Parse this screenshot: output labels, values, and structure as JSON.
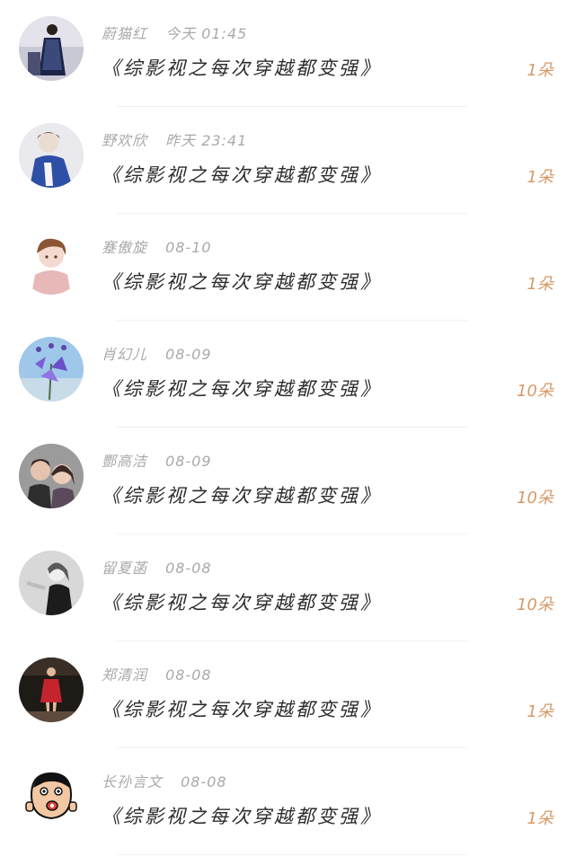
{
  "messages": [
    {
      "name": "蔚猫红",
      "time": "今天 01:45",
      "title": "《综影视之每次穿越都变强》",
      "count": "1朵",
      "avatar_icon": "woman-in-navy-dress-avatar",
      "avatar_colors": [
        "#3b4a7a",
        "#c9c9d6",
        "#1c2448"
      ]
    },
    {
      "name": "野欢欣",
      "time": "昨天 23:41",
      "title": "《综影视之每次穿越都变强》",
      "count": "1朵",
      "avatar_icon": "young-man-blue-outfit-avatar",
      "avatar_colors": [
        "#2e4fa6",
        "#e9ddd2",
        "#7a5a3a"
      ]
    },
    {
      "name": "蹇傲旋",
      "time": "08-10",
      "title": "《综影视之每次穿越都变强》",
      "count": "1朵",
      "avatar_icon": "anime-boy-avatar",
      "avatar_colors": [
        "#8a5532",
        "#f3d9cf",
        "#e8b7b8"
      ]
    },
    {
      "name": "肖幻儿",
      "time": "08-09",
      "title": "《综影视之每次穿越都变强》",
      "count": "10朵",
      "avatar_icon": "purple-flowers-avatar",
      "avatar_colors": [
        "#7b5fd6",
        "#9ec7ea",
        "#4c6e46"
      ]
    },
    {
      "name": "酆高洁",
      "time": "08-09",
      "title": "《综影视之每次穿越都变强》",
      "count": "10朵",
      "avatar_icon": "couple-selfie-avatar",
      "avatar_colors": [
        "#3a2a24",
        "#e6c3ae",
        "#9b9b9b"
      ]
    },
    {
      "name": "留夏菡",
      "time": "08-08",
      "title": "《综影视之每次穿越都变强》",
      "count": "10朵",
      "avatar_icon": "bw-woman-portrait-avatar",
      "avatar_colors": [
        "#d8d8d8",
        "#5a5a5a",
        "#1c1c1c"
      ]
    },
    {
      "name": "郑清润",
      "time": "08-08",
      "title": "《综影视之每次穿越都变强》",
      "count": "1朵",
      "avatar_icon": "woman-red-dress-avatar",
      "avatar_colors": [
        "#1e1a16",
        "#c4242e",
        "#5d4b3d"
      ]
    },
    {
      "name": "长孙言文",
      "time": "08-08",
      "title": "《综影视之每次穿越都变强》",
      "count": "1朵",
      "avatar_icon": "cartoon-boy-avatar",
      "avatar_colors": [
        "#ffffff",
        "#f2c7a3",
        "#111111"
      ]
    }
  ]
}
